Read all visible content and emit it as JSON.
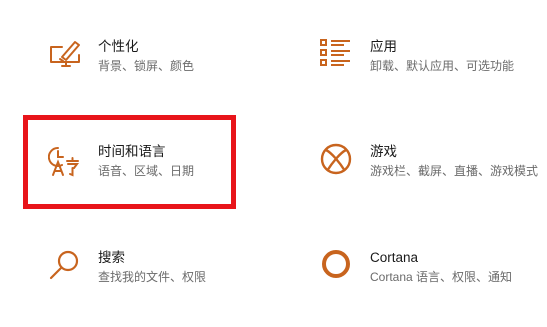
{
  "accent_color": "#c8641e",
  "highlight_color": "#e8141a",
  "tiles": [
    {
      "icon": "personalization-icon",
      "title": "个性化",
      "desc": "背景、锁屏、颜色"
    },
    {
      "icon": "apps-icon",
      "title": "应用",
      "desc": "卸载、默认应用、可选功能"
    },
    {
      "icon": "time-language-icon",
      "title": "时间和语言",
      "desc": "语音、区域、日期"
    },
    {
      "icon": "xbox-icon",
      "title": "游戏",
      "desc": "游戏栏、截屏、直播、游戏模式"
    },
    {
      "icon": "search-icon",
      "title": "搜索",
      "desc": "查找我的文件、权限"
    },
    {
      "icon": "cortana-icon",
      "title": "Cortana",
      "desc": "Cortana 语言、权限、通知"
    }
  ]
}
